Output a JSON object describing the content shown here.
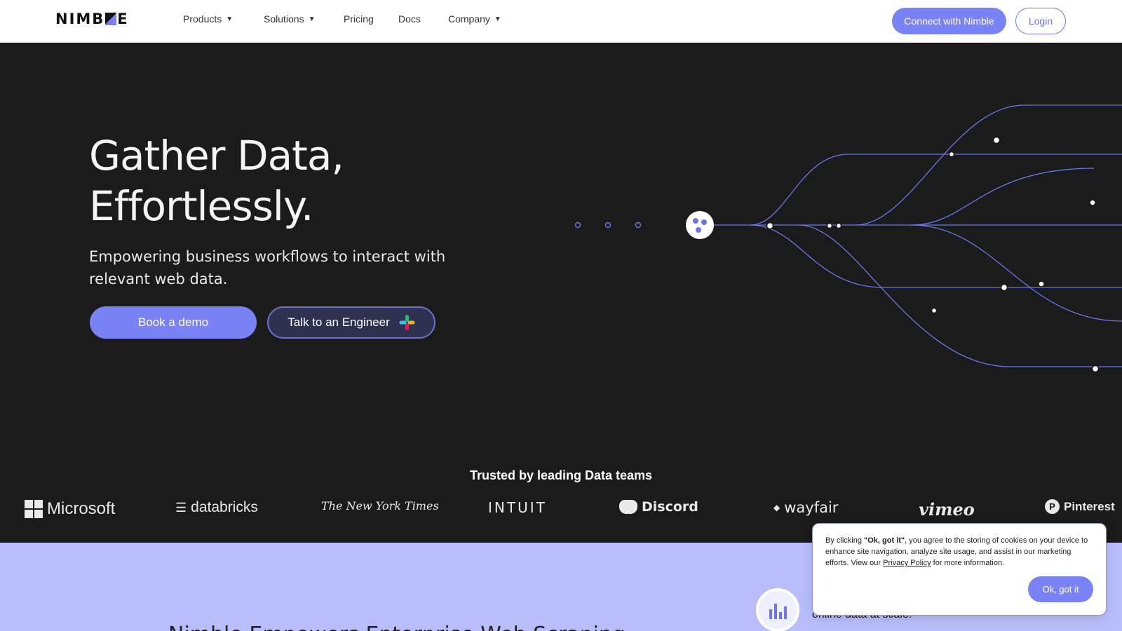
{
  "brand": {
    "logo_left": "NIMB",
    "logo_right": "E"
  },
  "nav": {
    "items": [
      {
        "label": "Products",
        "has_dropdown": true
      },
      {
        "label": "Solutions",
        "has_dropdown": true
      },
      {
        "label": "Pricing",
        "has_dropdown": false
      },
      {
        "label": "Docs",
        "has_dropdown": false
      },
      {
        "label": "Company",
        "has_dropdown": true
      }
    ],
    "connect_label": "Connect with Nimble",
    "login_label": "Login"
  },
  "hero": {
    "title_line1": "Gather Data,",
    "title_line2": "Effortlessly.",
    "subtitle": "Empowering business workflows to interact with relevant web data.",
    "demo_label": "Book a demo",
    "engineer_label": "Talk to an Engineer"
  },
  "trusted": {
    "heading": "Trusted by leading Data teams",
    "logos": [
      "Microsoft",
      "databricks",
      "The New York Times",
      "INTUIT",
      "Discord",
      "wayfair",
      "vimeo",
      "Pinterest"
    ]
  },
  "band": {
    "text_fragment": "online data at scale.",
    "heading_fragment": "Nimble Empowers Enterprise Web Scraping"
  },
  "cookie": {
    "text_before": "By clicking ",
    "text_bold": "\"Ok, got it\"",
    "text_middle": ", you agree to the storing of cookies on your device to enhance site navigation, analyze site usage, and assist in our marketing efforts. View our ",
    "link_label": "Privacy Policy",
    "text_after": " for more information.",
    "ok_label": "Ok, got it"
  },
  "colors": {
    "accent": "#7a83f5",
    "hero_bg": "#1b1b1c",
    "band_bg": "#b9befb"
  }
}
